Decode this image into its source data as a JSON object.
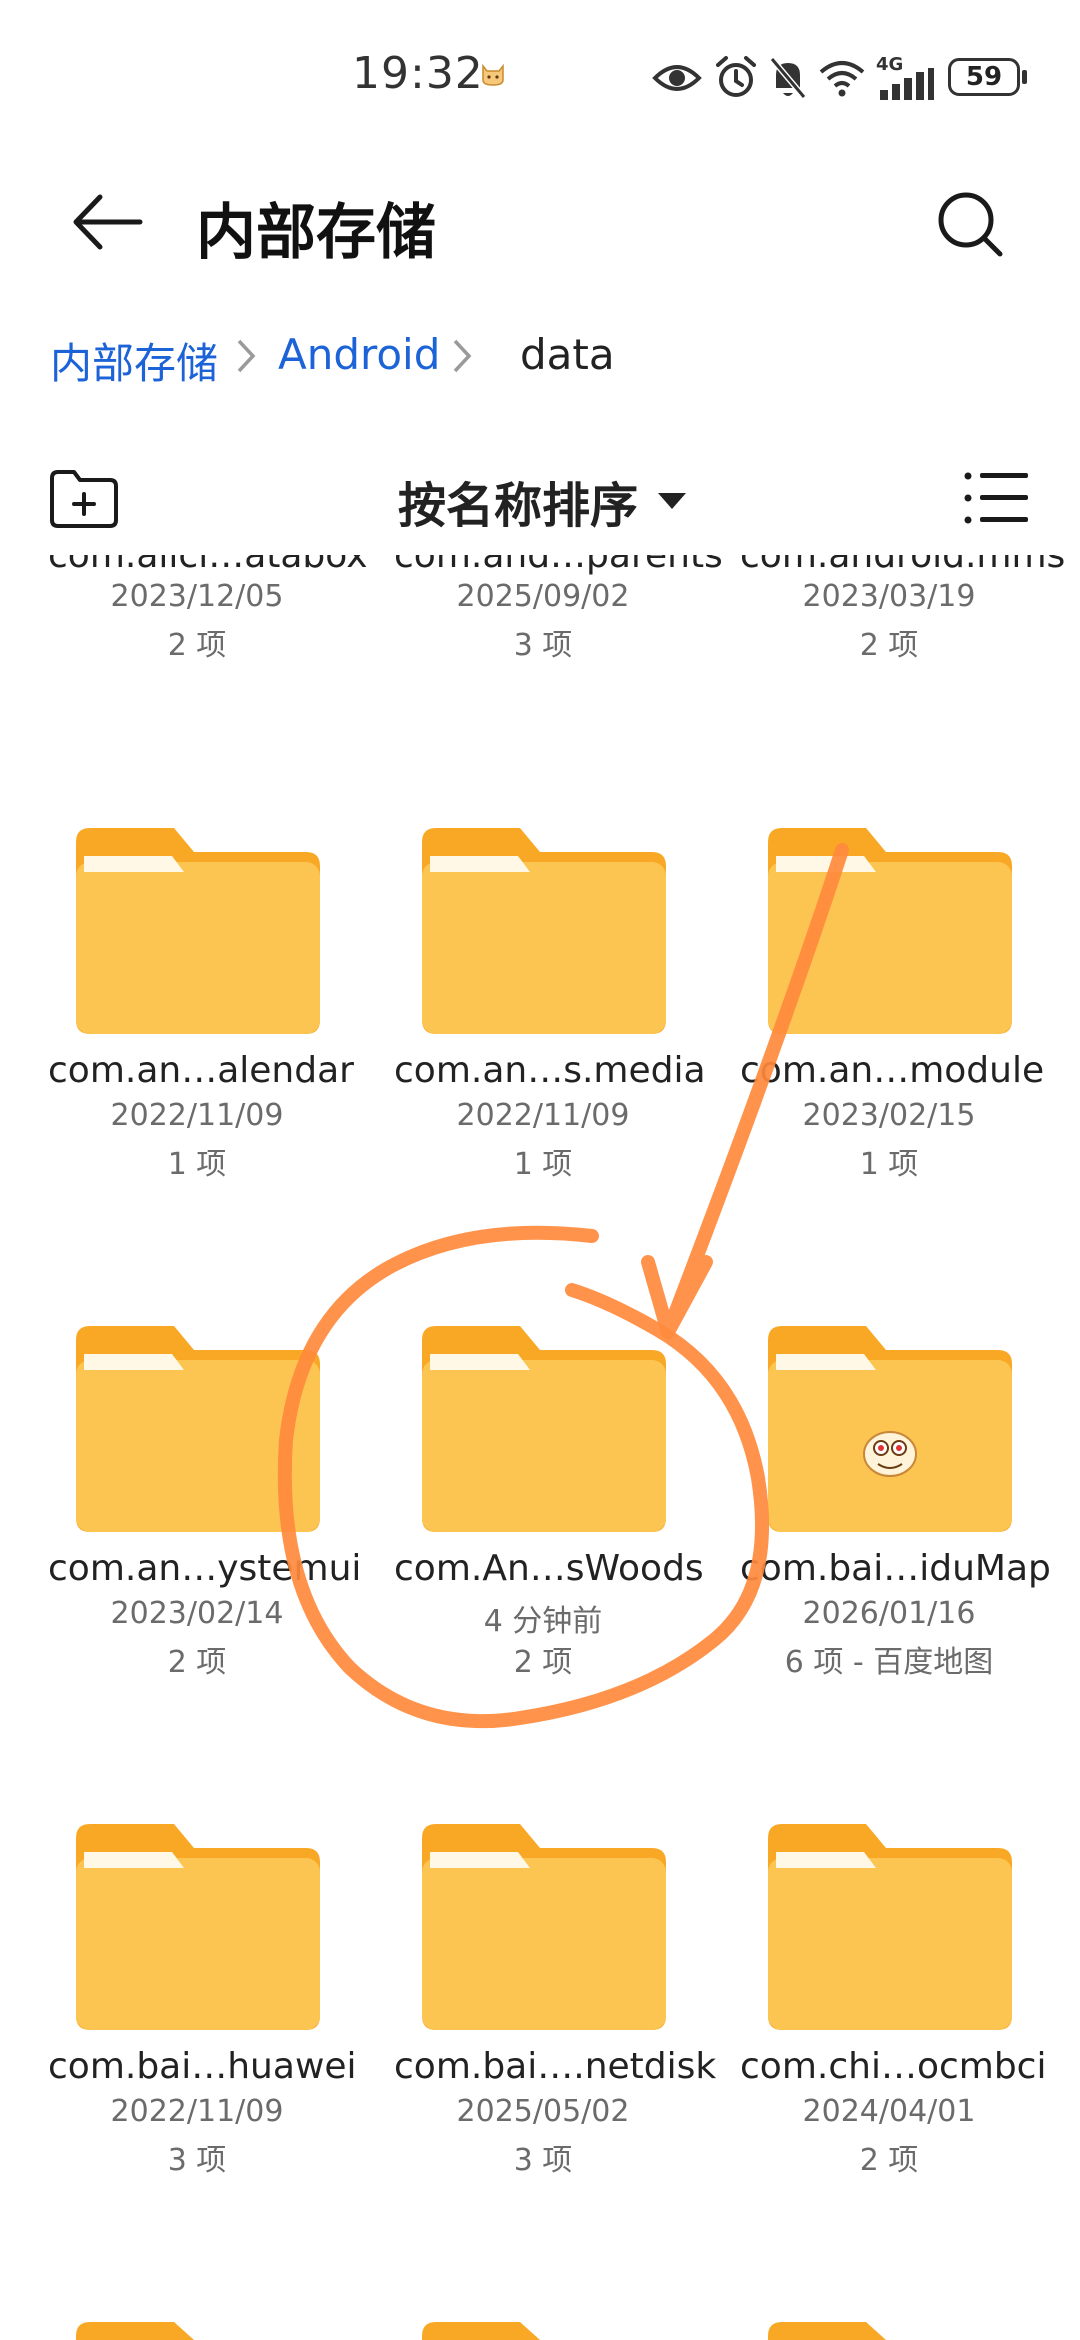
{
  "status_bar": {
    "time": "19:32",
    "network": "4G",
    "battery": "59"
  },
  "header": {
    "title": "内部存储"
  },
  "breadcrumb": {
    "items": [
      "内部存储",
      "Android",
      "data"
    ]
  },
  "toolbar": {
    "sort_label": "按名称排序"
  },
  "colors": {
    "accent": "#1d63d8",
    "folder": "#fcc552",
    "folder_tab": "#f9a825",
    "annotation": "#ff8a3d"
  },
  "partial_row": [
    {
      "name": "com.alici…atabox",
      "date": "2023/12/05",
      "count": "2 项"
    },
    {
      "name": "com.and…parents",
      "date": "2025/09/02",
      "count": "3 项"
    },
    {
      "name": "com.android.mms",
      "date": "2023/03/19",
      "count": "2 项"
    }
  ],
  "folders": [
    {
      "name": "com.an…alendar",
      "date": "2022/11/09",
      "count": "1 项"
    },
    {
      "name": "com.an…s.media",
      "date": "2022/11/09",
      "count": "1 项"
    },
    {
      "name": "com.an…module",
      "date": "2023/02/15",
      "count": "1 项"
    },
    {
      "name": "com.an…ystemui",
      "date": "2023/02/14",
      "count": "2 项"
    },
    {
      "name": "com.An…sWoods",
      "date": "4 分钟前",
      "count": "2 项"
    },
    {
      "name": "com.bai…iduMap",
      "date": "2026/01/16",
      "count": "6 项 - 百度地图"
    },
    {
      "name": "com.bai…huawei",
      "date": "2022/11/09",
      "count": "3 项"
    },
    {
      "name": "com.bai….netdisk",
      "date": "2025/05/02",
      "count": "3 项"
    },
    {
      "name": "com.chi…ocmbci",
      "date": "2024/04/01",
      "count": "2 项"
    }
  ]
}
